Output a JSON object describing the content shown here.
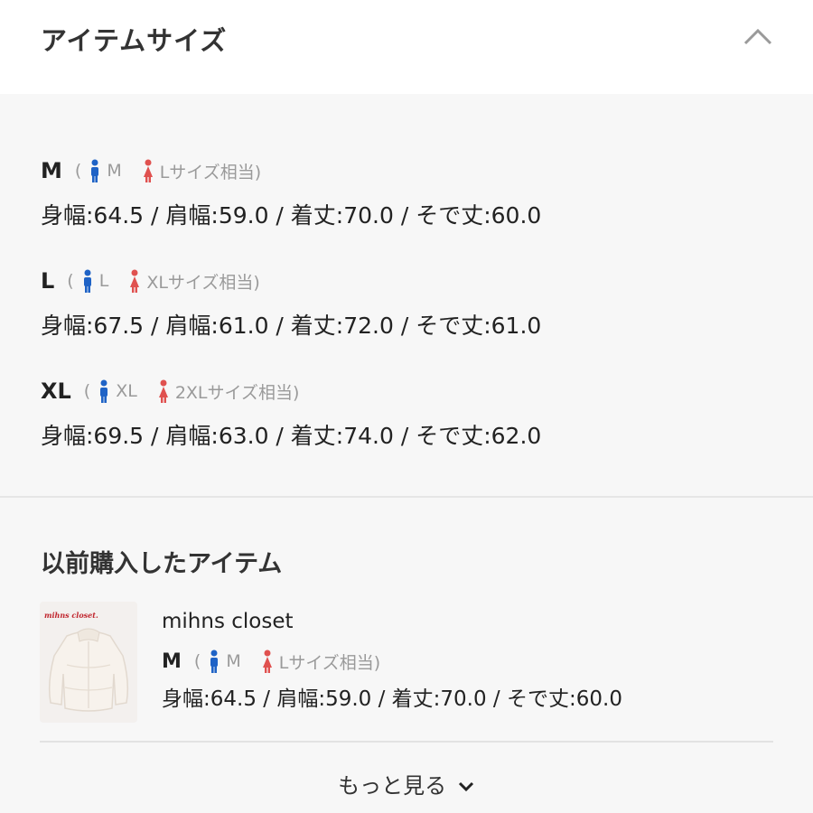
{
  "header": {
    "title": "アイテムサイズ",
    "collapse_icon": "chevron-up-icon"
  },
  "sizes": [
    {
      "size": "M",
      "open_paren": "(",
      "male_size": "M",
      "female_size": "Lサイズ相当)",
      "measurements": "身幅:64.5 / 肩幅:59.0 / 着丈:70.0 / そで丈:60.0"
    },
    {
      "size": "L",
      "open_paren": "(",
      "male_size": "L",
      "female_size": "XLサイズ相当)",
      "measurements": "身幅:67.5 / 肩幅:61.0 / 着丈:72.0 / そで丈:61.0"
    },
    {
      "size": "XL",
      "open_paren": "(",
      "male_size": "XL",
      "female_size": "2XLサイズ相当)",
      "measurements": "身幅:69.5 / 肩幅:63.0 / 着丈:74.0 / そで丈:62.0"
    }
  ],
  "previous": {
    "title": "以前購入したアイテム",
    "item": {
      "thumb_brand": "mihns closet.",
      "brand": "mihns closet",
      "size": "M",
      "open_paren": "(",
      "male_size": "M",
      "female_size": "Lサイズ相当)",
      "measurements": "身幅:64.5 / 肩幅:59.0 / 着丈:70.0 / そで丈:60.0"
    }
  },
  "more": {
    "label": "もっと見る"
  },
  "colors": {
    "male_icon": "#1f63c6",
    "female_icon": "#e0514f",
    "muted_text": "#9a9a9a"
  }
}
